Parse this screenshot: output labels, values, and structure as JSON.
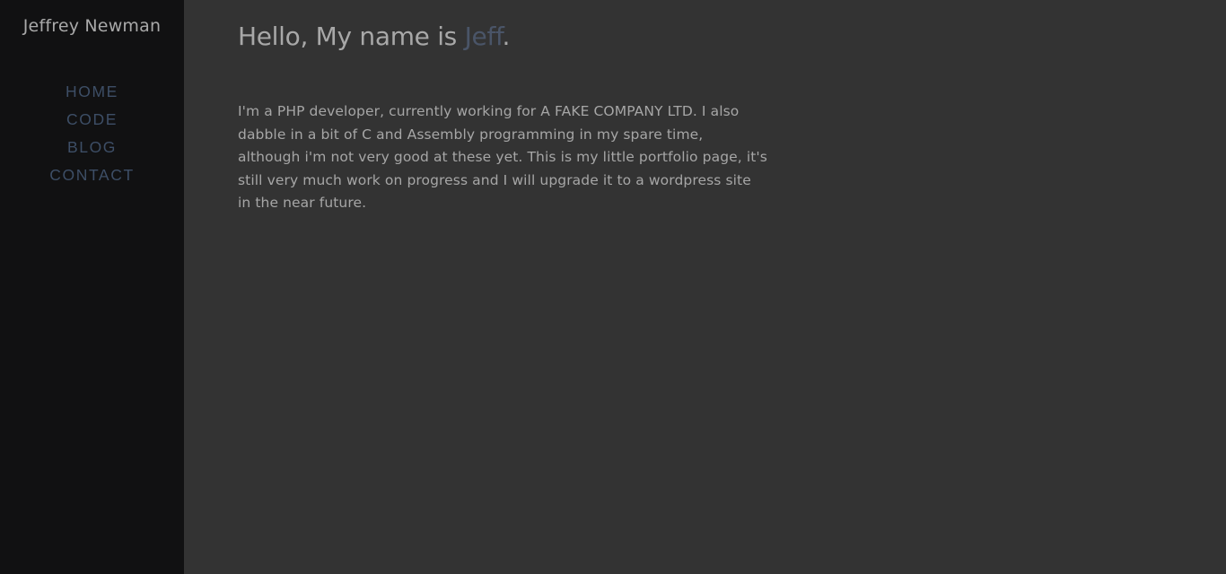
{
  "sidebar": {
    "site_title": "Jeffrey Newman",
    "nav": [
      {
        "label": "HOME"
      },
      {
        "label": "CODE"
      },
      {
        "label": "BLOG"
      },
      {
        "label": "CONTACT"
      }
    ]
  },
  "main": {
    "heading": {
      "prefix": "Hello, My name is ",
      "name": "Jeff",
      "suffix": "."
    },
    "intro": "I'm a PHP developer, currently working for A FAKE COMPANY LTD. I also dabble in a bit of C and Assembly programming in my spare time, although i'm not very good at these yet. This is my little portfolio page, it's still very much work on progress and I will upgrade it to a wordpress site in the near future."
  },
  "colors": {
    "sidebar_bg": "#111112",
    "main_bg": "#333333",
    "text": "#a8a8a8",
    "accent": "#3d4e66"
  }
}
